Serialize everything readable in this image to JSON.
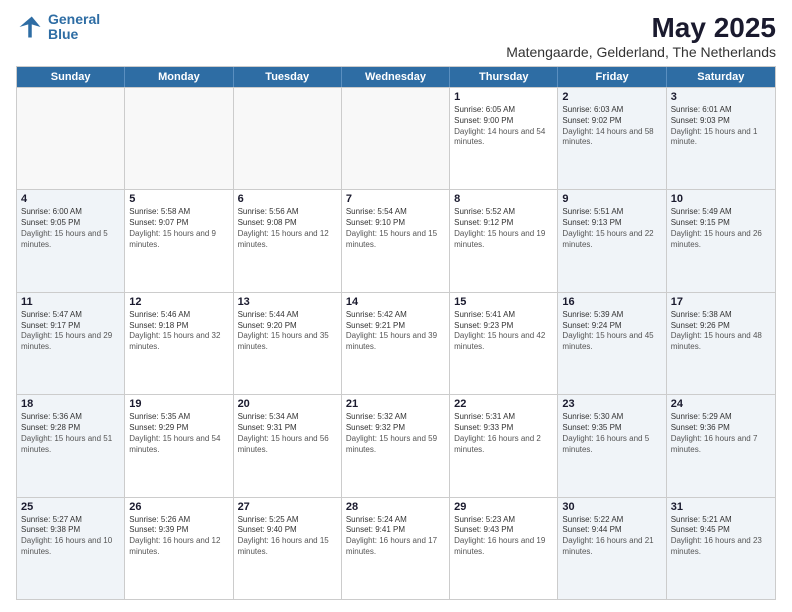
{
  "logo": {
    "line1": "General",
    "line2": "Blue"
  },
  "title": "May 2025",
  "location": "Matengaarde, Gelderland, The Netherlands",
  "weekdays": [
    "Sunday",
    "Monday",
    "Tuesday",
    "Wednesday",
    "Thursday",
    "Friday",
    "Saturday"
  ],
  "rows": [
    [
      {
        "day": "",
        "sunrise": "",
        "sunset": "",
        "daylight": "",
        "empty": true
      },
      {
        "day": "",
        "sunrise": "",
        "sunset": "",
        "daylight": "",
        "empty": true
      },
      {
        "day": "",
        "sunrise": "",
        "sunset": "",
        "daylight": "",
        "empty": true
      },
      {
        "day": "",
        "sunrise": "",
        "sunset": "",
        "daylight": "",
        "empty": true
      },
      {
        "day": "1",
        "sunrise": "Sunrise: 6:05 AM",
        "sunset": "Sunset: 9:00 PM",
        "daylight": "Daylight: 14 hours and 54 minutes."
      },
      {
        "day": "2",
        "sunrise": "Sunrise: 6:03 AM",
        "sunset": "Sunset: 9:02 PM",
        "daylight": "Daylight: 14 hours and 58 minutes.",
        "weekend": true
      },
      {
        "day": "3",
        "sunrise": "Sunrise: 6:01 AM",
        "sunset": "Sunset: 9:03 PM",
        "daylight": "Daylight: 15 hours and 1 minute.",
        "weekend": true
      }
    ],
    [
      {
        "day": "4",
        "sunrise": "Sunrise: 6:00 AM",
        "sunset": "Sunset: 9:05 PM",
        "daylight": "Daylight: 15 hours and 5 minutes.",
        "weekend": true
      },
      {
        "day": "5",
        "sunrise": "Sunrise: 5:58 AM",
        "sunset": "Sunset: 9:07 PM",
        "daylight": "Daylight: 15 hours and 9 minutes."
      },
      {
        "day": "6",
        "sunrise": "Sunrise: 5:56 AM",
        "sunset": "Sunset: 9:08 PM",
        "daylight": "Daylight: 15 hours and 12 minutes."
      },
      {
        "day": "7",
        "sunrise": "Sunrise: 5:54 AM",
        "sunset": "Sunset: 9:10 PM",
        "daylight": "Daylight: 15 hours and 15 minutes."
      },
      {
        "day": "8",
        "sunrise": "Sunrise: 5:52 AM",
        "sunset": "Sunset: 9:12 PM",
        "daylight": "Daylight: 15 hours and 19 minutes."
      },
      {
        "day": "9",
        "sunrise": "Sunrise: 5:51 AM",
        "sunset": "Sunset: 9:13 PM",
        "daylight": "Daylight: 15 hours and 22 minutes.",
        "weekend": true
      },
      {
        "day": "10",
        "sunrise": "Sunrise: 5:49 AM",
        "sunset": "Sunset: 9:15 PM",
        "daylight": "Daylight: 15 hours and 26 minutes.",
        "weekend": true
      }
    ],
    [
      {
        "day": "11",
        "sunrise": "Sunrise: 5:47 AM",
        "sunset": "Sunset: 9:17 PM",
        "daylight": "Daylight: 15 hours and 29 minutes.",
        "weekend": true
      },
      {
        "day": "12",
        "sunrise": "Sunrise: 5:46 AM",
        "sunset": "Sunset: 9:18 PM",
        "daylight": "Daylight: 15 hours and 32 minutes."
      },
      {
        "day": "13",
        "sunrise": "Sunrise: 5:44 AM",
        "sunset": "Sunset: 9:20 PM",
        "daylight": "Daylight: 15 hours and 35 minutes."
      },
      {
        "day": "14",
        "sunrise": "Sunrise: 5:42 AM",
        "sunset": "Sunset: 9:21 PM",
        "daylight": "Daylight: 15 hours and 39 minutes."
      },
      {
        "day": "15",
        "sunrise": "Sunrise: 5:41 AM",
        "sunset": "Sunset: 9:23 PM",
        "daylight": "Daylight: 15 hours and 42 minutes."
      },
      {
        "day": "16",
        "sunrise": "Sunrise: 5:39 AM",
        "sunset": "Sunset: 9:24 PM",
        "daylight": "Daylight: 15 hours and 45 minutes.",
        "weekend": true
      },
      {
        "day": "17",
        "sunrise": "Sunrise: 5:38 AM",
        "sunset": "Sunset: 9:26 PM",
        "daylight": "Daylight: 15 hours and 48 minutes.",
        "weekend": true
      }
    ],
    [
      {
        "day": "18",
        "sunrise": "Sunrise: 5:36 AM",
        "sunset": "Sunset: 9:28 PM",
        "daylight": "Daylight: 15 hours and 51 minutes.",
        "weekend": true
      },
      {
        "day": "19",
        "sunrise": "Sunrise: 5:35 AM",
        "sunset": "Sunset: 9:29 PM",
        "daylight": "Daylight: 15 hours and 54 minutes."
      },
      {
        "day": "20",
        "sunrise": "Sunrise: 5:34 AM",
        "sunset": "Sunset: 9:31 PM",
        "daylight": "Daylight: 15 hours and 56 minutes."
      },
      {
        "day": "21",
        "sunrise": "Sunrise: 5:32 AM",
        "sunset": "Sunset: 9:32 PM",
        "daylight": "Daylight: 15 hours and 59 minutes."
      },
      {
        "day": "22",
        "sunrise": "Sunrise: 5:31 AM",
        "sunset": "Sunset: 9:33 PM",
        "daylight": "Daylight: 16 hours and 2 minutes."
      },
      {
        "day": "23",
        "sunrise": "Sunrise: 5:30 AM",
        "sunset": "Sunset: 9:35 PM",
        "daylight": "Daylight: 16 hours and 5 minutes.",
        "weekend": true
      },
      {
        "day": "24",
        "sunrise": "Sunrise: 5:29 AM",
        "sunset": "Sunset: 9:36 PM",
        "daylight": "Daylight: 16 hours and 7 minutes.",
        "weekend": true
      }
    ],
    [
      {
        "day": "25",
        "sunrise": "Sunrise: 5:27 AM",
        "sunset": "Sunset: 9:38 PM",
        "daylight": "Daylight: 16 hours and 10 minutes.",
        "weekend": true
      },
      {
        "day": "26",
        "sunrise": "Sunrise: 5:26 AM",
        "sunset": "Sunset: 9:39 PM",
        "daylight": "Daylight: 16 hours and 12 minutes."
      },
      {
        "day": "27",
        "sunrise": "Sunrise: 5:25 AM",
        "sunset": "Sunset: 9:40 PM",
        "daylight": "Daylight: 16 hours and 15 minutes."
      },
      {
        "day": "28",
        "sunrise": "Sunrise: 5:24 AM",
        "sunset": "Sunset: 9:41 PM",
        "daylight": "Daylight: 16 hours and 17 minutes."
      },
      {
        "day": "29",
        "sunrise": "Sunrise: 5:23 AM",
        "sunset": "Sunset: 9:43 PM",
        "daylight": "Daylight: 16 hours and 19 minutes."
      },
      {
        "day": "30",
        "sunrise": "Sunrise: 5:22 AM",
        "sunset": "Sunset: 9:44 PM",
        "daylight": "Daylight: 16 hours and 21 minutes.",
        "weekend": true
      },
      {
        "day": "31",
        "sunrise": "Sunrise: 5:21 AM",
        "sunset": "Sunset: 9:45 PM",
        "daylight": "Daylight: 16 hours and 23 minutes.",
        "weekend": true
      }
    ]
  ]
}
